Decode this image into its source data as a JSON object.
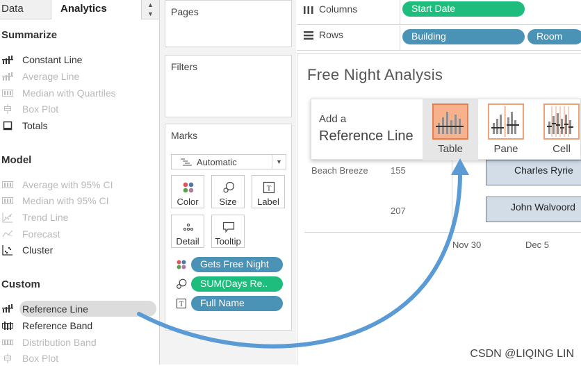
{
  "tabs": {
    "data": "Data",
    "analytics": "Analytics",
    "scroll": "▲▼"
  },
  "analytics": {
    "summarize": {
      "title": "Summarize",
      "items": [
        {
          "label": "Constant Line",
          "enabled": true,
          "icon": "constant-line-icon"
        },
        {
          "label": "Average Line",
          "enabled": false,
          "icon": "average-line-icon"
        },
        {
          "label": "Median with Quartiles",
          "enabled": false,
          "icon": "median-quartiles-icon"
        },
        {
          "label": "Box Plot",
          "enabled": false,
          "icon": "box-plot-icon"
        },
        {
          "label": "Totals",
          "enabled": true,
          "icon": "totals-icon"
        }
      ]
    },
    "model": {
      "title": "Model",
      "items": [
        {
          "label": "Average with 95% CI",
          "enabled": false,
          "icon": "average-ci-icon"
        },
        {
          "label": "Median with 95% CI",
          "enabled": false,
          "icon": "median-ci-icon"
        },
        {
          "label": "Trend Line",
          "enabled": false,
          "icon": "trend-line-icon"
        },
        {
          "label": "Forecast",
          "enabled": false,
          "icon": "forecast-icon"
        },
        {
          "label": "Cluster",
          "enabled": true,
          "icon": "cluster-icon"
        }
      ]
    },
    "custom": {
      "title": "Custom",
      "items": [
        {
          "label": "Reference Line",
          "enabled": true,
          "icon": "reference-line-icon"
        },
        {
          "label": "Reference Band",
          "enabled": true,
          "icon": "reference-band-icon"
        },
        {
          "label": "Distribution Band",
          "enabled": false,
          "icon": "distribution-band-icon"
        },
        {
          "label": "Box Plot",
          "enabled": false,
          "icon": "box-plot-icon"
        }
      ]
    }
  },
  "cards": {
    "pages": "Pages",
    "filters": "Filters",
    "marks": "Marks"
  },
  "marks": {
    "type": "Automatic",
    "buttons": {
      "color": "Color",
      "size": "Size",
      "label": "Label",
      "detail": "Detail",
      "tooltip": "Tooltip"
    },
    "pills": {
      "color": "Gets Free Night",
      "size": "SUM(Days Re..",
      "label": "Full Name"
    }
  },
  "shelves": {
    "columns_label": "Columns",
    "rows_label": "Rows",
    "columns": [
      "Start Date"
    ],
    "rows": [
      "Building",
      "Room"
    ]
  },
  "viz": {
    "title": "Free Night Analysis",
    "rows": [
      {
        "building": "Beach Breeze",
        "room": "155",
        "name": "Charles Ryrie"
      },
      {
        "building": "",
        "room": "207",
        "name": "John Walvoord"
      }
    ],
    "axis_ticks": [
      "Nov 30",
      "Dec 5"
    ]
  },
  "popup": {
    "line1": "Add a",
    "line2": "Reference Line",
    "options": [
      "Table",
      "Pane",
      "Cell"
    ],
    "selected": "Table"
  },
  "colors": {
    "green_pill": "#1ebd7e",
    "blue_pill": "#4a93b6",
    "arrow": "#5b9bd5",
    "highlight": "#f7b18d"
  },
  "watermark": "CSDN @LIQING LIN"
}
